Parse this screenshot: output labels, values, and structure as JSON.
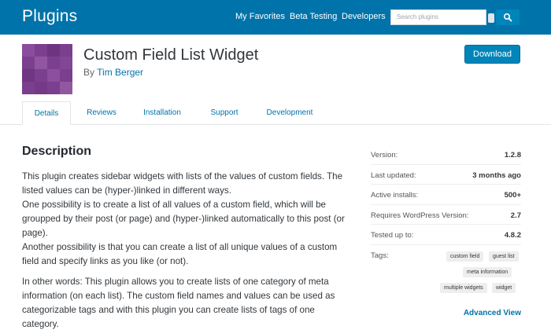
{
  "header": {
    "brand": "Plugins",
    "nav": [
      {
        "label": "My Favorites"
      },
      {
        "label": "Beta Testing"
      },
      {
        "label": "Developers"
      }
    ],
    "search_placeholder": "Search plugins"
  },
  "plugin": {
    "title": "Custom Field List Widget",
    "by_label": "By",
    "author": "Tim Berger",
    "download_label": "Download",
    "icon_color": "#7b3f8f"
  },
  "tabs": [
    {
      "label": "Details",
      "active": true
    },
    {
      "label": "Reviews"
    },
    {
      "label": "Installation"
    },
    {
      "label": "Support"
    },
    {
      "label": "Development"
    }
  ],
  "description": {
    "heading": "Description",
    "paragraphs": [
      "This plugin creates sidebar widgets with lists of the values of custom fields. The listed values can be (hyper-)linked in different ways.",
      "One possibility is to create a list of all values of a custom field, which will be groupped by their post (or page) and (hyper-)linked automatically to this post (or page).",
      "Another possibility is that you can create a list of all unique values of a custom field and specify links as you like (or not).",
      "In other words: This plugin allows you to create lists of one category of meta information (on each list). The custom field names and values can be used as categorizable tags and with this plugin you can create lists of tags of one category."
    ]
  },
  "meta": {
    "rows": [
      {
        "label": "Version:",
        "value": "1.2.8"
      },
      {
        "label": "Last updated:",
        "value": "3 months ago"
      },
      {
        "label": "Active installs:",
        "value": "500+"
      },
      {
        "label": "Requires WordPress Version:",
        "value": "2.7"
      },
      {
        "label": "Tested up to:",
        "value": "4.8.2"
      }
    ],
    "tags_label": "Tags:",
    "tags": [
      "custom field",
      "guest list",
      "meta information",
      "multiple widgets",
      "widget"
    ],
    "advanced_view": "Advanced View"
  },
  "colors": {
    "header_bg": "#0073aa",
    "link": "#0073aa",
    "button": "#0085ba"
  }
}
